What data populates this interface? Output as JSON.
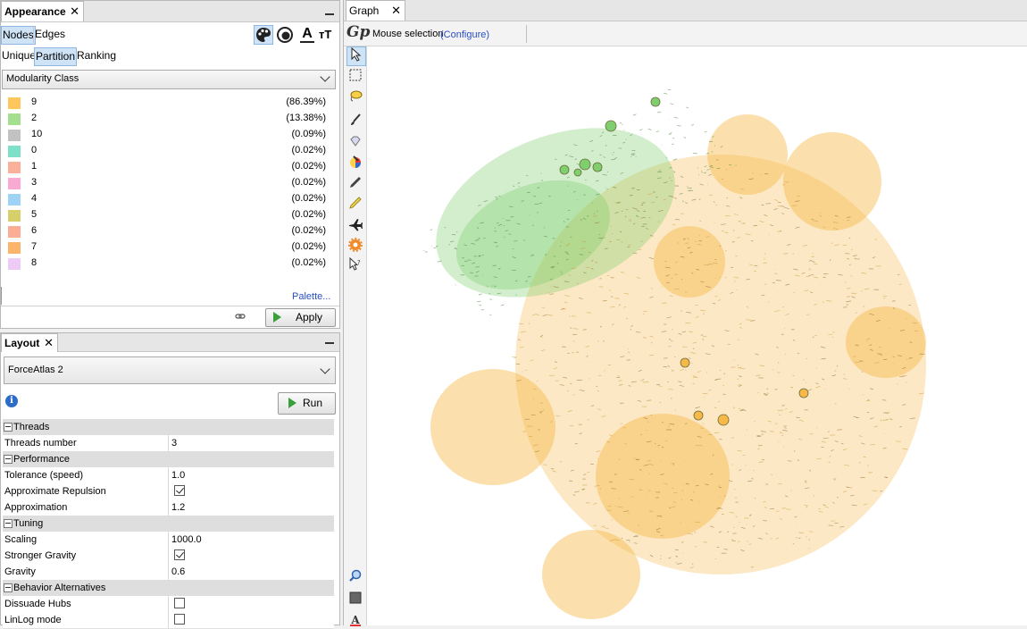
{
  "appearance": {
    "tab_title": "Appearance",
    "tab_close": "✕",
    "element_tabs": [
      "Nodes",
      "Edges"
    ],
    "mode_tabs": [
      "Unique",
      "Partition",
      "Ranking"
    ],
    "attribute": "Modularity Class",
    "toolbar_icons": [
      "palette-icon",
      "size-icon",
      "label-color-icon",
      "label-size-icon"
    ],
    "legend": [
      {
        "name": "9",
        "percent": "(86.39%)",
        "color": "#ffc65c"
      },
      {
        "name": "2",
        "percent": "(13.38%)",
        "color": "#a3df8e"
      },
      {
        "name": "10",
        "percent": "(0.09%)",
        "color": "#c2c2c2"
      },
      {
        "name": "0",
        "percent": "(0.02%)",
        "color": "#7ee0c8"
      },
      {
        "name": "1",
        "percent": "(0.02%)",
        "color": "#fbb09a"
      },
      {
        "name": "3",
        "percent": "(0.02%)",
        "color": "#f9a9d2"
      },
      {
        "name": "4",
        "percent": "(0.02%)",
        "color": "#9fd3f5"
      },
      {
        "name": "5",
        "percent": "(0.02%)",
        "color": "#d6cf6a"
      },
      {
        "name": "6",
        "percent": "(0.02%)",
        "color": "#fcae94"
      },
      {
        "name": "7",
        "percent": "(0.02%)",
        "color": "#fbb46a"
      },
      {
        "name": "8",
        "percent": "(0.02%)",
        "color": "#eecbf7"
      }
    ],
    "palette_link": "Palette...",
    "apply_label": "Apply"
  },
  "layout": {
    "tab_title": "Layout",
    "tab_close": "✕",
    "algorithm": "ForceAtlas 2",
    "run_label": "Run",
    "sections": [
      {
        "title": "Threads",
        "props": [
          {
            "key": "Threads number",
            "value": "3"
          }
        ]
      },
      {
        "title": "Performance",
        "props": [
          {
            "key": "Tolerance (speed)",
            "value": "1.0"
          },
          {
            "key": "Approximate Repulsion",
            "checked": true
          },
          {
            "key": "Approximation",
            "value": "1.2"
          }
        ]
      },
      {
        "title": "Tuning",
        "props": [
          {
            "key": "Scaling",
            "value": "1000.0"
          },
          {
            "key": "Stronger Gravity",
            "checked": true
          },
          {
            "key": "Gravity",
            "value": "0.6"
          }
        ]
      },
      {
        "title": "Behavior Alternatives",
        "props": [
          {
            "key": "Dissuade Hubs",
            "checked": false
          },
          {
            "key": "LinLog mode",
            "checked": false
          }
        ]
      }
    ]
  },
  "graph": {
    "tab_title": "Graph",
    "tab_close": "✕",
    "mode_label": "Mouse selection",
    "configure_link": "(Configure)",
    "colors": {
      "community_main": "#f6b847",
      "community_secondary": "#7fcf6e"
    },
    "tools": [
      "cursor-icon",
      "rectangle-select-icon",
      "lasso-icon",
      "brush-icon",
      "diamond-icon",
      "color-picker-icon",
      "pencil-icon",
      "ruler-icon",
      "airplane-icon",
      "gear-icon",
      "help-cursor-icon"
    ],
    "bottom_tools": [
      "zoom-icon",
      "background-color-icon",
      "label-icon"
    ],
    "bottom_label_glyph": "A"
  }
}
